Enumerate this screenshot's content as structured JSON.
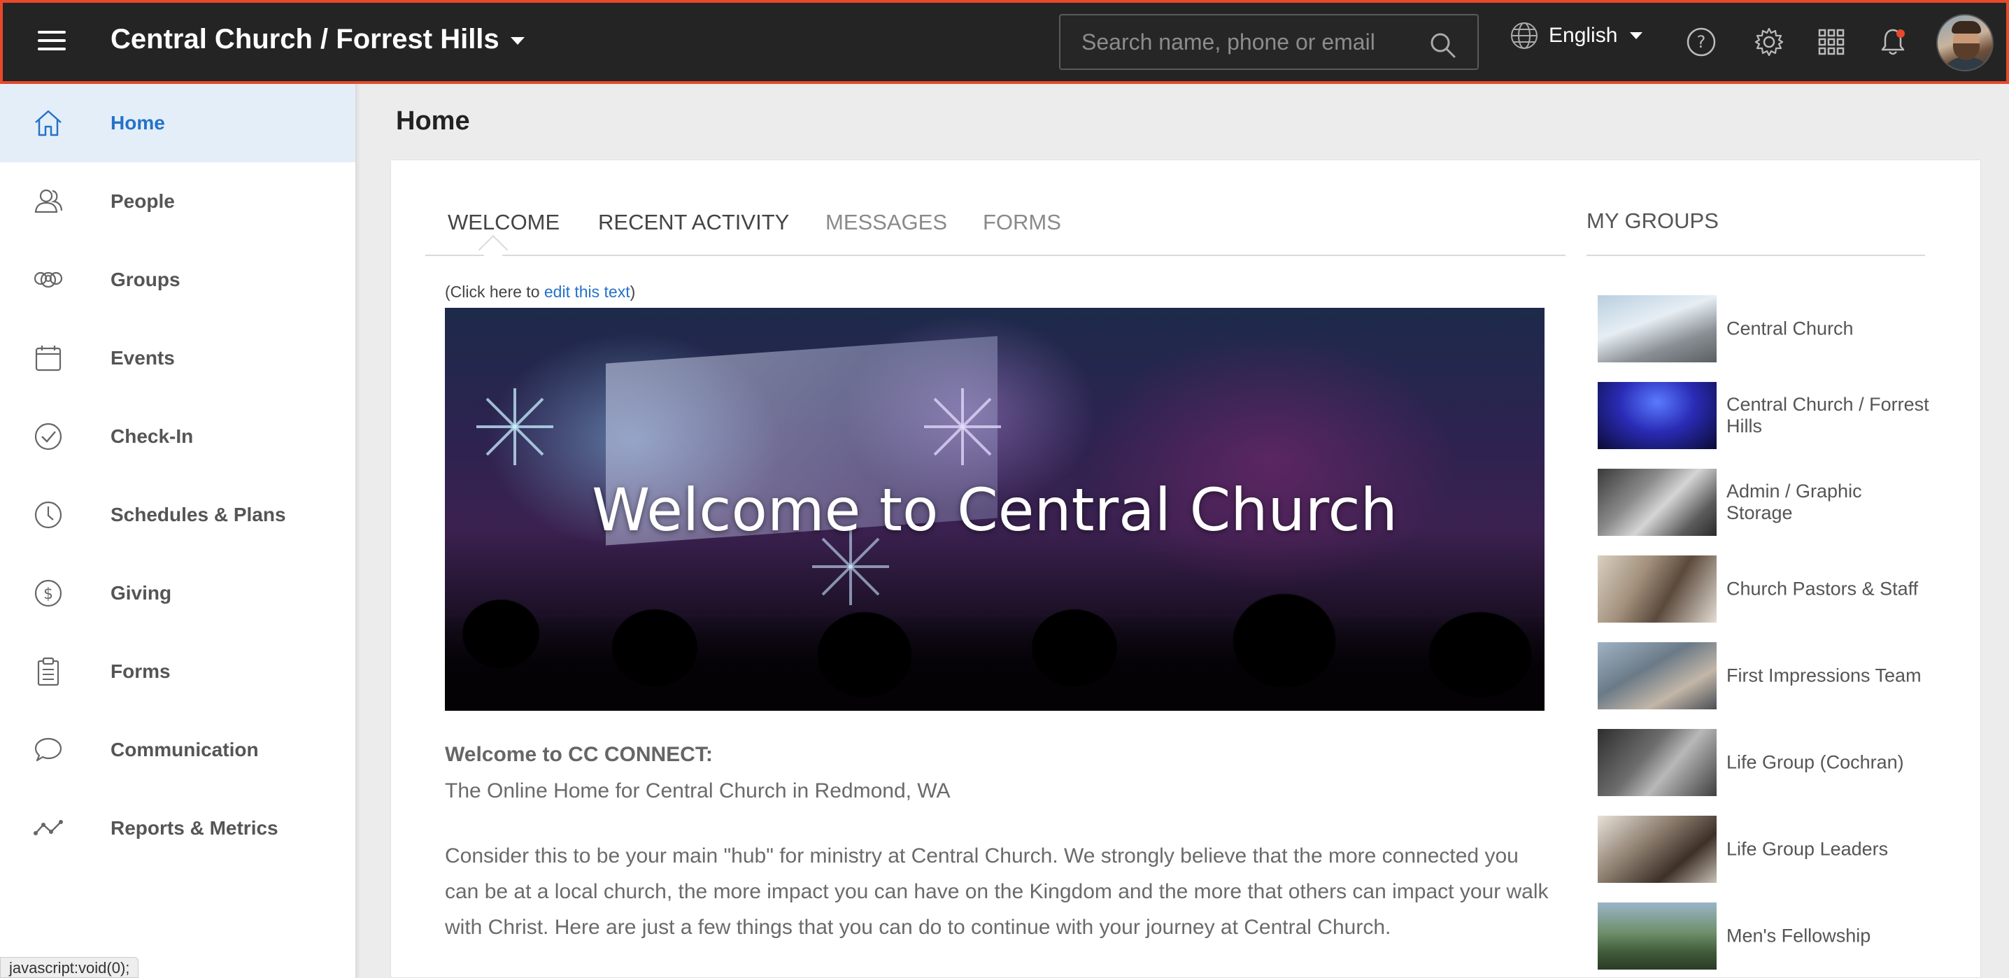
{
  "header": {
    "org_title": "Central Church / Forrest Hills",
    "search_placeholder": "Search name, phone or email",
    "language": "English"
  },
  "sidebar": {
    "items": [
      {
        "label": "Home",
        "icon": "home-icon",
        "active": true
      },
      {
        "label": "People",
        "icon": "people-icon"
      },
      {
        "label": "Groups",
        "icon": "groups-icon"
      },
      {
        "label": "Events",
        "icon": "calendar-icon"
      },
      {
        "label": "Check-In",
        "icon": "checkin-icon"
      },
      {
        "label": "Schedules & Plans",
        "icon": "clock-icon"
      },
      {
        "label": "Giving",
        "icon": "dollar-icon"
      },
      {
        "label": "Forms",
        "icon": "clipboard-icon"
      },
      {
        "label": "Communication",
        "icon": "chat-icon"
      },
      {
        "label": "Reports & Metrics",
        "icon": "metrics-icon"
      }
    ]
  },
  "main": {
    "page_title": "Home",
    "tabs": [
      {
        "label": "WELCOME",
        "active": true
      },
      {
        "label": "RECENT ACTIVITY"
      },
      {
        "label": "MESSAGES"
      },
      {
        "label": "FORMS"
      }
    ],
    "edit_note_prefix": "(Click here to ",
    "edit_note_link": "edit this text",
    "edit_note_suffix": ")",
    "banner_title": "Welcome to Central Church",
    "welcome_heading": "Welcome to CC CONNECT:",
    "welcome_subheading": "The Online Home for Central Church in Redmond, WA",
    "welcome_body": "Consider this to be your main \"hub\" for ministry at Central Church. We strongly believe that the more connected you can be at a local church, the more impact you can have on the Kingdom and the more that others can impact your walk with Christ. Here are just a few things that you can do to continue with your journey at Central Church."
  },
  "my_groups": {
    "title": "MY GROUPS",
    "items": [
      {
        "name": "Central Church"
      },
      {
        "name": "Central Church / Forrest Hills"
      },
      {
        "name": "Admin / Graphic Storage"
      },
      {
        "name": "Church Pastors & Staff"
      },
      {
        "name": "First Impressions Team"
      },
      {
        "name": "Life Group (Cochran)"
      },
      {
        "name": "Life Group Leaders"
      },
      {
        "name": "Men's Fellowship"
      }
    ]
  },
  "status_bar": "javascript:void(0);",
  "colors": {
    "accent": "#2572c8",
    "topbar_bg": "#242424",
    "topbar_border": "#e8492c",
    "active_nav_bg": "#e4eef9",
    "notification_dot": "#e8492c"
  }
}
